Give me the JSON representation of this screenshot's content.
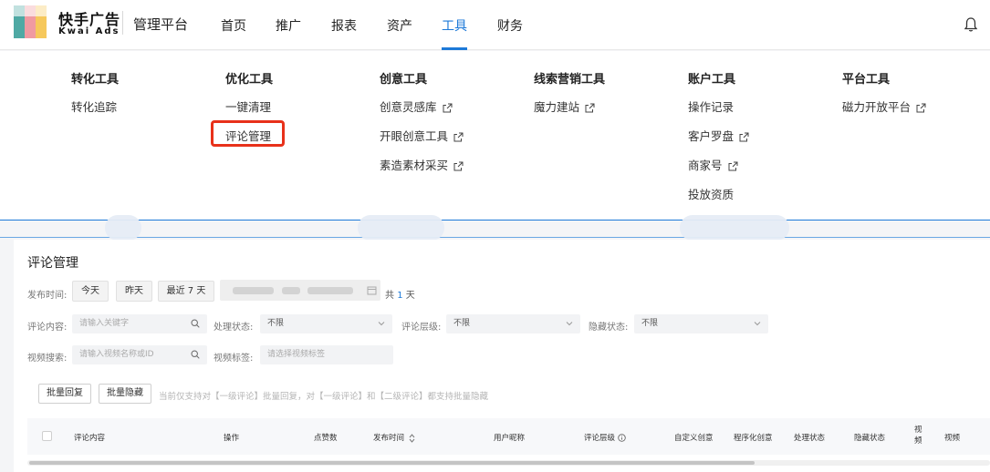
{
  "brand": {
    "cn": "快手广告",
    "en": "Kwai Ads",
    "platform": "管理平台"
  },
  "nav": [
    {
      "label": "首页",
      "active": false
    },
    {
      "label": "推广",
      "active": false
    },
    {
      "label": "报表",
      "active": false
    },
    {
      "label": "资产",
      "active": false
    },
    {
      "label": "工具",
      "active": true
    },
    {
      "label": "财务",
      "active": false
    }
  ],
  "menu": {
    "conversion": {
      "title": "转化工具",
      "items": [
        "转化追踪"
      ]
    },
    "optimize": {
      "title": "优化工具",
      "items": [
        "一键清理",
        "评论管理"
      ]
    },
    "creative": {
      "title": "创意工具",
      "items": [
        "创意灵感库",
        "开眼创意工具",
        "素造素材采买"
      ]
    },
    "leads": {
      "title": "线索营销工具",
      "items": [
        "魔力建站"
      ]
    },
    "account": {
      "title": "账户工具",
      "items": [
        "操作记录",
        "客户罗盘",
        "商家号",
        "投放资质"
      ]
    },
    "platform": {
      "title": "平台工具",
      "items": [
        "磁力开放平台"
      ]
    }
  },
  "page": {
    "title": "评论管理",
    "publish_time_label": "发布时间:",
    "quick_dates": [
      "今天",
      "昨天",
      "最近 7 天"
    ],
    "total_prefix": "共",
    "total_num": "1",
    "total_suffix": "天",
    "comment_label": "评论内容:",
    "comment_placeholder": "请输入关键字",
    "handle_label": "处理状态:",
    "handle_value": "不限",
    "level_label": "评论层级:",
    "level_value": "不限",
    "hidden_label": "隐藏状态:",
    "hidden_value": "不限",
    "video_search_label": "视频搜索:",
    "video_search_placeholder": "请输入视频名称或ID",
    "video_tag_label": "视频标签:",
    "video_tag_placeholder": "请选择视频标签",
    "batch_reply": "批量回复",
    "batch_hide": "批量隐藏",
    "hint": "当前仅支持对【一级评论】批量回复，对【一级评论】和【二级评论】都支持批量隐藏"
  },
  "table": {
    "headers": {
      "content": "评论内容",
      "action": "操作",
      "likes": "点赞数",
      "publish": "发布时间",
      "nickname": "用户昵称",
      "level": "评论层级",
      "custom": "自定义创意",
      "programmatic": "程序化创意",
      "handle": "处理状态",
      "hidden": "隐藏状态",
      "video_a": "视",
      "video_b": "频",
      "video_more": "视频"
    }
  }
}
